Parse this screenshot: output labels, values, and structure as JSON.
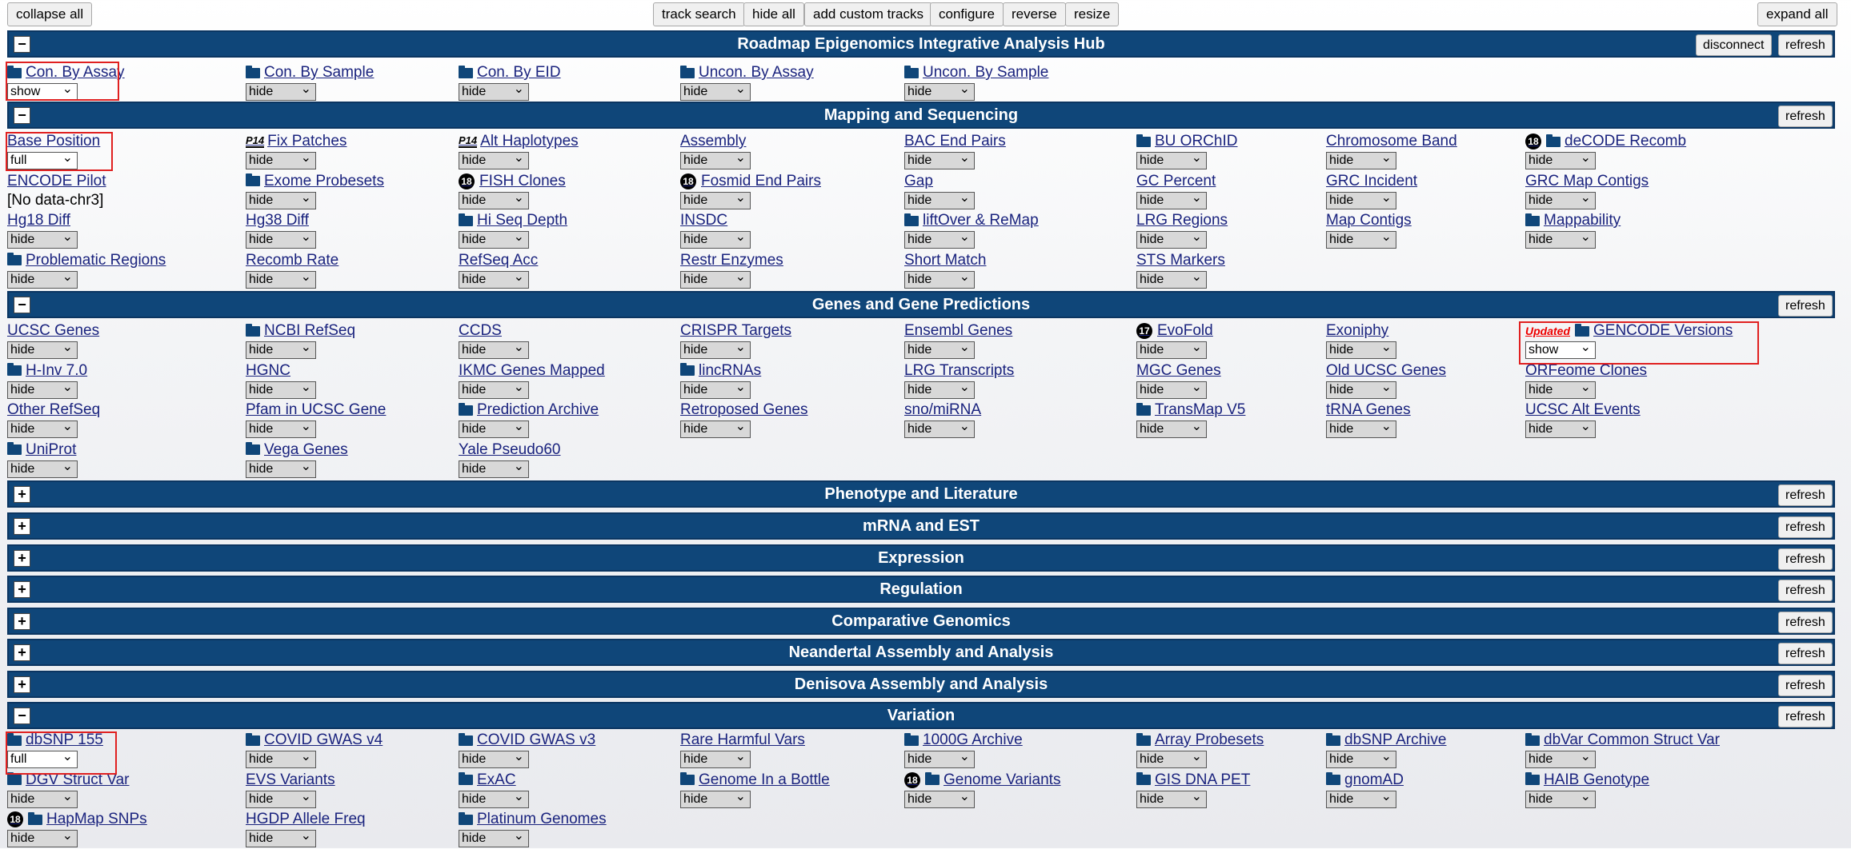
{
  "toolbar": {
    "collapse_all": "collapse all",
    "track_search": "track search",
    "hide_all": "hide all",
    "add_custom_tracks": "add custom tracks",
    "configure": "configure",
    "reverse": "reverse",
    "resize": "resize",
    "expand_all": "expand all"
  },
  "groups": {
    "roadmap": {
      "title": "Roadmap Epigenomics Integrative Analysis Hub",
      "toggle": "−",
      "disconnect": "disconnect",
      "refresh": "refresh"
    },
    "mapping": {
      "title": "Mapping and Sequencing",
      "toggle": "−",
      "refresh": "refresh"
    },
    "genes": {
      "title": "Genes and Gene Predictions",
      "toggle": "−",
      "refresh": "refresh"
    },
    "phenotype": {
      "title": "Phenotype and Literature",
      "toggle": "+",
      "refresh": "refresh"
    },
    "mrna": {
      "title": "mRNA and EST",
      "toggle": "+",
      "refresh": "refresh"
    },
    "expression": {
      "title": "Expression",
      "toggle": "+",
      "refresh": "refresh"
    },
    "regulation": {
      "title": "Regulation",
      "toggle": "+",
      "refresh": "refresh"
    },
    "comparative": {
      "title": "Comparative Genomics",
      "toggle": "+",
      "refresh": "refresh"
    },
    "neandertal": {
      "title": "Neandertal Assembly and Analysis",
      "toggle": "+",
      "refresh": "refresh"
    },
    "denisova": {
      "title": "Denisova Assembly and Analysis",
      "toggle": "+",
      "refresh": "refresh"
    },
    "variation": {
      "title": "Variation",
      "toggle": "−",
      "refresh": "refresh"
    }
  },
  "tracks": {
    "roadmap": [
      {
        "label": "Con. By Assay",
        "folder": true,
        "value": "show"
      },
      {
        "label": "Con. By Sample",
        "folder": true,
        "value": "hide"
      },
      {
        "label": "Con. By EID",
        "folder": true,
        "value": "hide"
      },
      {
        "label": "Uncon. By Assay",
        "folder": true,
        "value": "hide"
      },
      {
        "label": "Uncon. By Sample",
        "folder": true,
        "value": "hide"
      }
    ],
    "mapping": [
      {
        "label": "Base Position",
        "value": "full"
      },
      {
        "label": "Fix Patches",
        "badge": "P14",
        "value": "hide"
      },
      {
        "label": "Alt Haplotypes",
        "badge": "P14",
        "value": "hide"
      },
      {
        "label": "Assembly",
        "value": "hide"
      },
      {
        "label": "BAC End Pairs",
        "value": "hide"
      },
      {
        "label": "BU ORChID",
        "folder": true,
        "value": "hide"
      },
      {
        "label": "Chromosome Band",
        "value": "hide"
      },
      {
        "label": "deCODE Recomb",
        "circle": "18",
        "folder": true,
        "value": "hide"
      },
      {
        "label": "ENCODE Pilot",
        "nodata": "[No data-chr3]"
      },
      {
        "label": "Exome Probesets",
        "folder": true,
        "value": "hide"
      },
      {
        "label": "FISH Clones",
        "circle": "18",
        "value": "hide"
      },
      {
        "label": "Fosmid End Pairs",
        "circle": "18",
        "value": "hide"
      },
      {
        "label": "Gap",
        "value": "hide"
      },
      {
        "label": "GC Percent",
        "value": "hide"
      },
      {
        "label": "GRC Incident",
        "value": "hide"
      },
      {
        "label": "GRC Map Contigs",
        "value": "hide"
      },
      {
        "label": "Hg18 Diff",
        "value": "hide"
      },
      {
        "label": "Hg38 Diff",
        "value": "hide"
      },
      {
        "label": "Hi Seq Depth",
        "folder": true,
        "value": "hide"
      },
      {
        "label": "INSDC",
        "value": "hide"
      },
      {
        "label": "liftOver & ReMap",
        "folder": true,
        "value": "hide"
      },
      {
        "label": "LRG Regions",
        "value": "hide"
      },
      {
        "label": "Map Contigs",
        "value": "hide"
      },
      {
        "label": "Mappability",
        "folder": true,
        "value": "hide"
      },
      {
        "label": "Problematic Regions",
        "folder": true,
        "value": "hide"
      },
      {
        "label": "Recomb Rate",
        "value": "hide"
      },
      {
        "label": "RefSeq Acc",
        "value": "hide"
      },
      {
        "label": "Restr Enzymes",
        "value": "hide"
      },
      {
        "label": "Short Match",
        "value": "hide"
      },
      {
        "label": "STS Markers",
        "value": "hide"
      }
    ],
    "genes": [
      {
        "label": "UCSC Genes",
        "value": "hide"
      },
      {
        "label": "NCBI RefSeq",
        "folder": true,
        "value": "hide"
      },
      {
        "label": "CCDS",
        "value": "hide"
      },
      {
        "label": "CRISPR Targets",
        "value": "hide"
      },
      {
        "label": "Ensembl Genes",
        "value": "hide"
      },
      {
        "label": "EvoFold",
        "circle": "17",
        "value": "hide"
      },
      {
        "label": "Exoniphy",
        "value": "hide"
      },
      {
        "label": "GENCODE Versions",
        "updated": "Updated",
        "folder": true,
        "value": "show"
      },
      {
        "label": "H-Inv 7.0",
        "folder": true,
        "value": "hide"
      },
      {
        "label": "HGNC",
        "value": "hide"
      },
      {
        "label": "IKMC Genes Mapped",
        "value": "hide"
      },
      {
        "label": "lincRNAs",
        "folder": true,
        "value": "hide"
      },
      {
        "label": "LRG Transcripts",
        "value": "hide"
      },
      {
        "label": "MGC Genes",
        "value": "hide"
      },
      {
        "label": "Old UCSC Genes",
        "value": "hide"
      },
      {
        "label": "ORFeome Clones",
        "value": "hide"
      },
      {
        "label": "Other RefSeq",
        "value": "hide"
      },
      {
        "label": "Pfam in UCSC Gene",
        "value": "hide"
      },
      {
        "label": "Prediction Archive",
        "folder": true,
        "value": "hide"
      },
      {
        "label": "Retroposed Genes",
        "value": "hide"
      },
      {
        "label": "sno/miRNA",
        "value": "hide"
      },
      {
        "label": "TransMap V5",
        "folder": true,
        "value": "hide"
      },
      {
        "label": "tRNA Genes",
        "value": "hide"
      },
      {
        "label": "UCSC Alt Events",
        "value": "hide"
      },
      {
        "label": "UniProt",
        "folder": true,
        "value": "hide"
      },
      {
        "label": "Vega Genes",
        "folder": true,
        "value": "hide"
      },
      {
        "label": "Yale Pseudo60",
        "value": "hide"
      }
    ],
    "variation": [
      {
        "label": "dbSNP 155",
        "folder": true,
        "value": "full"
      },
      {
        "label": "COVID GWAS v4",
        "folder": true,
        "value": "hide"
      },
      {
        "label": "COVID GWAS v3",
        "folder": true,
        "value": "hide"
      },
      {
        "label": "Rare Harmful Vars",
        "value": "hide"
      },
      {
        "label": "1000G Archive",
        "folder": true,
        "value": "hide"
      },
      {
        "label": "Array Probesets",
        "folder": true,
        "value": "hide"
      },
      {
        "label": "dbSNP Archive",
        "folder": true,
        "value": "hide"
      },
      {
        "label": "dbVar Common Struct Var",
        "folder": true,
        "value": "hide"
      },
      {
        "label": "DGV Struct Var",
        "folder": true,
        "value": "hide"
      },
      {
        "label": "EVS Variants",
        "value": "hide"
      },
      {
        "label": "ExAC",
        "folder": true,
        "value": "hide"
      },
      {
        "label": "Genome In a Bottle",
        "folder": true,
        "value": "hide"
      },
      {
        "label": "Genome Variants",
        "circle": "18",
        "folder": true,
        "value": "hide"
      },
      {
        "label": "GIS DNA PET",
        "folder": true,
        "value": "hide"
      },
      {
        "label": "gnomAD",
        "folder": true,
        "value": "hide"
      },
      {
        "label": "HAIB Genotype",
        "folder": true,
        "value": "hide"
      },
      {
        "label": "HapMap SNPs",
        "circle": "18",
        "folder": true,
        "value": "hide"
      },
      {
        "label": "HGDP Allele Freq",
        "value": "hide"
      },
      {
        "label": "Platinum Genomes",
        "folder": true,
        "value": "hide"
      }
    ]
  }
}
